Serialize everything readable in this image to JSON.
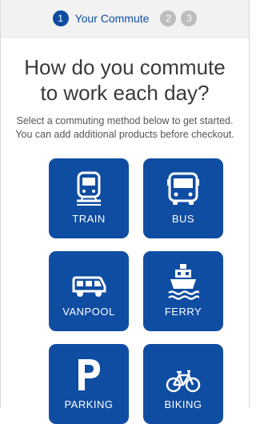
{
  "stepper": {
    "steps": [
      {
        "number": "1",
        "label": "Your Commute",
        "state": "active"
      },
      {
        "number": "2",
        "state": "inactive"
      },
      {
        "number": "3",
        "state": "inactive"
      }
    ]
  },
  "main": {
    "title": "How do you commute to work each day?",
    "subtitle": "Select a commuting method below to get started. You can add additional products before checkout."
  },
  "options": [
    {
      "label": "TRAIN",
      "icon": "train-icon"
    },
    {
      "label": "BUS",
      "icon": "bus-icon"
    },
    {
      "label": "VANPOOL",
      "icon": "van-icon"
    },
    {
      "label": "FERRY",
      "icon": "ferry-icon"
    },
    {
      "label": "PARKING",
      "icon": "parking-icon"
    },
    {
      "label": "BIKING",
      "icon": "bicycle-icon"
    }
  ],
  "colors": {
    "accent": "#0f4da2",
    "inactive_step": "#bdbdbd",
    "stepper_bg": "#f2f2f2"
  }
}
